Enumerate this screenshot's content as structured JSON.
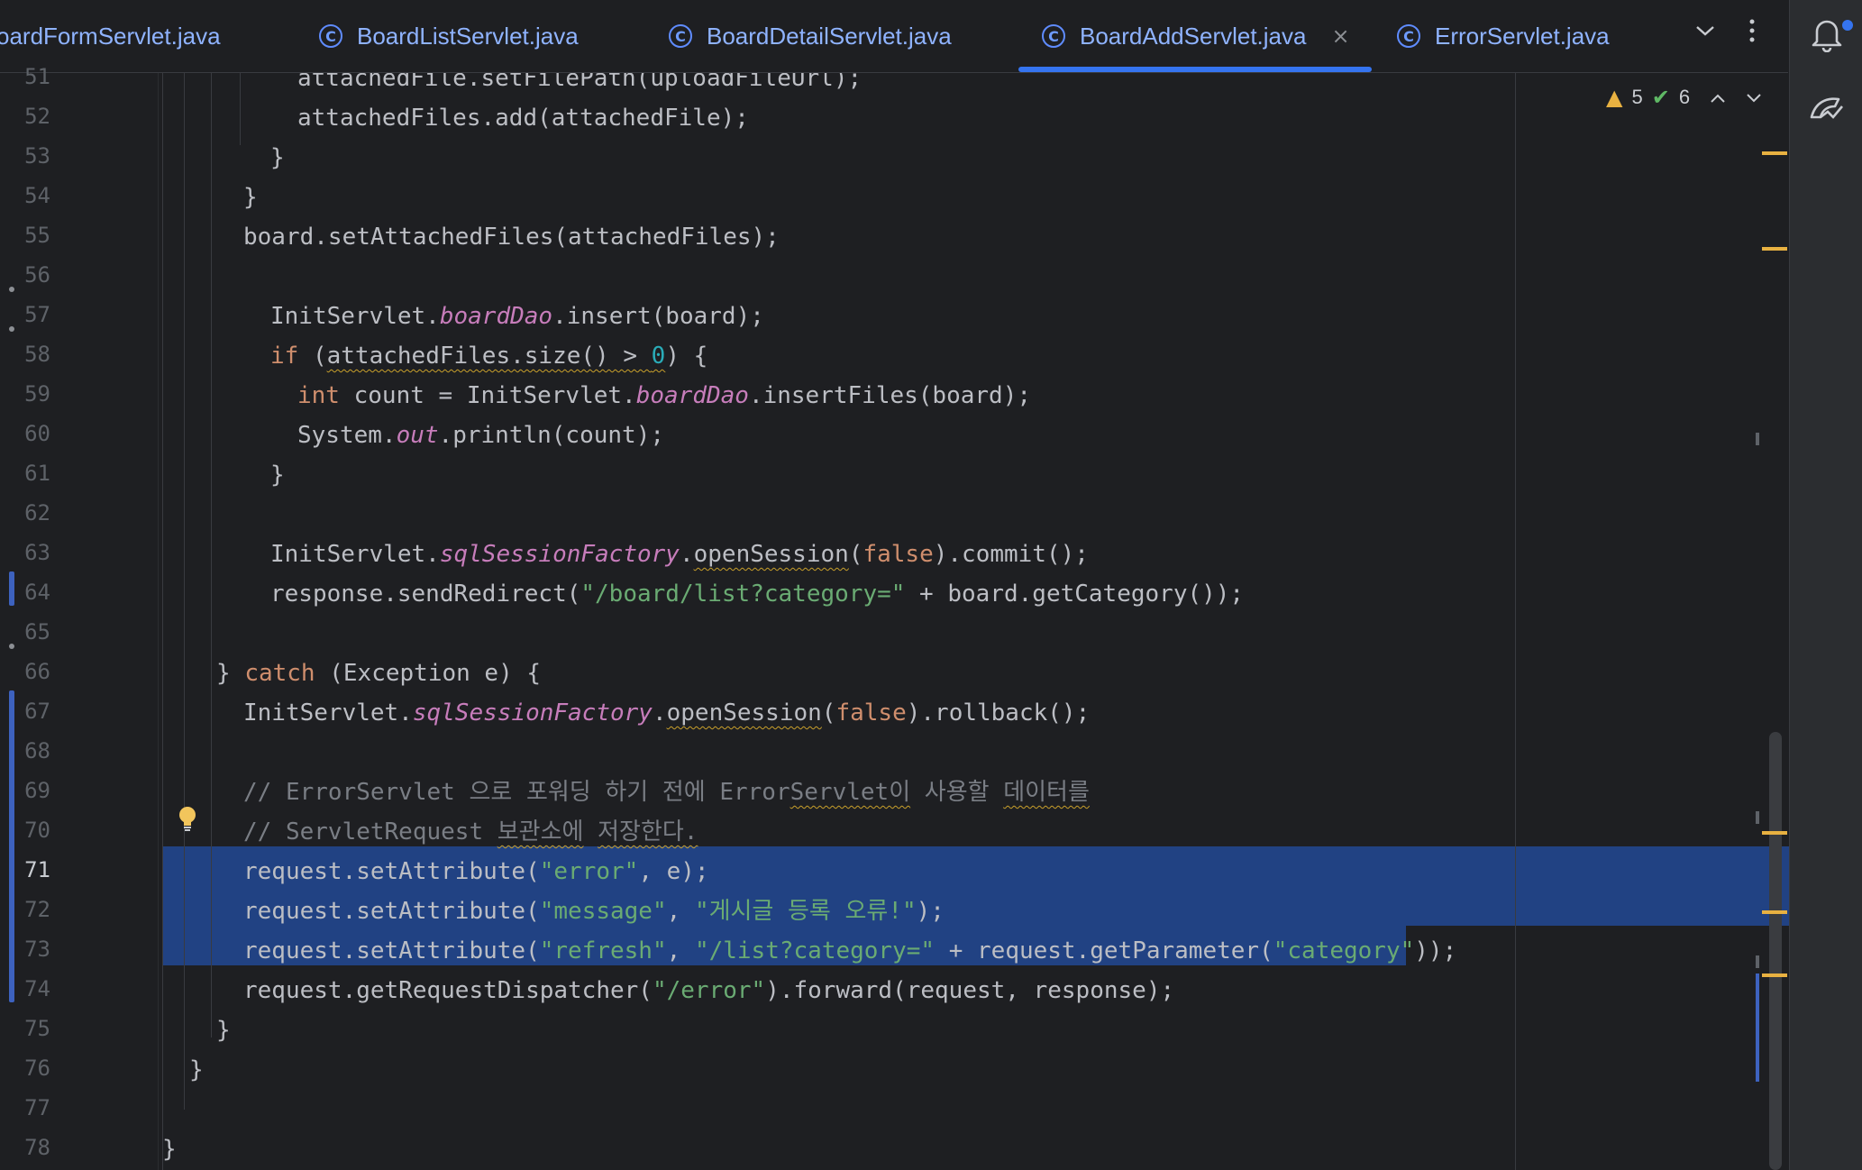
{
  "tabs": [
    {
      "label": "oardFormServlet.java",
      "active": false,
      "has_icon": false
    },
    {
      "label": "BoardListServlet.java",
      "active": false,
      "has_icon": true
    },
    {
      "label": "BoardDetailServlet.java",
      "active": false,
      "has_icon": true
    },
    {
      "label": "BoardAddServlet.java",
      "active": true,
      "has_icon": true
    },
    {
      "label": "ErrorServlet.java",
      "active": false,
      "has_icon": true
    }
  ],
  "tab_close_glyph": "×",
  "tab_icon_glyph": "C",
  "inspection": {
    "warnings": "5",
    "ok": "6"
  },
  "line_numbers": [
    "51",
    "52",
    "53",
    "54",
    "55",
    "56",
    "57",
    "58",
    "59",
    "60",
    "61",
    "62",
    "63",
    "64",
    "65",
    "66",
    "67",
    "68",
    "69",
    "70",
    "71",
    "72",
    "73",
    "74",
    "75",
    "76",
    "77",
    "78"
  ],
  "current_line": "71",
  "code": {
    "l51": "attachedFile.setFilePath(uploadFileUrl);",
    "l52": "attachedFiles.add(attachedFile);",
    "l53": "}",
    "l54": "}",
    "l55": "board.setAttachedFiles(attachedFiles);",
    "l57a": "InitServlet.",
    "l57b": "boardDao",
    "l57c": ".insert(board);",
    "l58a": "if",
    "l58b": " (",
    "l58c": "attachedFiles.size() > ",
    "l58d": "0",
    "l58e": ") {",
    "l59a": "int",
    "l59b": " count = InitServlet.",
    "l59c": "boardDao",
    "l59d": ".insertFiles(board);",
    "l60a": "System.",
    "l60b": "out",
    "l60c": ".println(count);",
    "l61": "}",
    "l63a": "InitServlet.",
    "l63b": "sqlSessionFactory",
    "l63c": ".",
    "l63d": "openSession",
    "l63e": "(",
    "l63f": "false",
    "l63g": ").commit();",
    "l64a": "response.sendRedirect(",
    "l64b": "\"/board/list?category=\"",
    "l64c": " + board.getCategory());",
    "l66a": "} ",
    "l66b": "catch",
    "l66c": " (Exception e) {",
    "l67a": "InitServlet.",
    "l67b": "sqlSessionFactory",
    "l67c": ".",
    "l67d": "openSession",
    "l67e": "(",
    "l67f": "false",
    "l67g": ").rollback();",
    "l69a": "// ErrorServlet 으로 포워딩 하기 전에 Error",
    "l69b": "Servlet이",
    "l69c": " 사용할 ",
    "l69d": "데이터를",
    "l70a": "// ServletRequest ",
    "l70b": "보관소에",
    "l70c": " ",
    "l70d": "저장한다.",
    "l71a": "request.setAttribute(",
    "l71b": "\"error\"",
    "l71c": ", e);",
    "l72a": "request.setAttribute(",
    "l72b": "\"message\"",
    "l72c": ", ",
    "l72d": "\"게시글 등록 오류!\"",
    "l72e": ");",
    "l73a": "request.setAttribute(",
    "l73b": "\"refresh\"",
    "l73c": ", ",
    "l73d": "\"/list?category=\"",
    "l73e": " + request.getParameter(",
    "l73f": "\"category\"",
    "l73g": "));",
    "l74a": "request.getRequestDispatcher(",
    "l74b": "\"/error\"",
    "l74c": ").forward(request, response);",
    "l75": "}",
    "l76": "}",
    "l78": "}"
  },
  "colors": {
    "keyword": "#cf8e6d",
    "string": "#6aab73",
    "number": "#2aacb8",
    "static_field": "#c77dbb",
    "comment": "#7a7e85",
    "selection": "#214283",
    "tab_accent": "#3574f0"
  },
  "icons": [
    "class-icon",
    "close-icon",
    "chevron-down-icon",
    "more-icon",
    "notification-bell-icon",
    "ai-assistant-icon",
    "warning-icon",
    "check-icon",
    "chevron-up-icon",
    "lightbulb-icon"
  ]
}
